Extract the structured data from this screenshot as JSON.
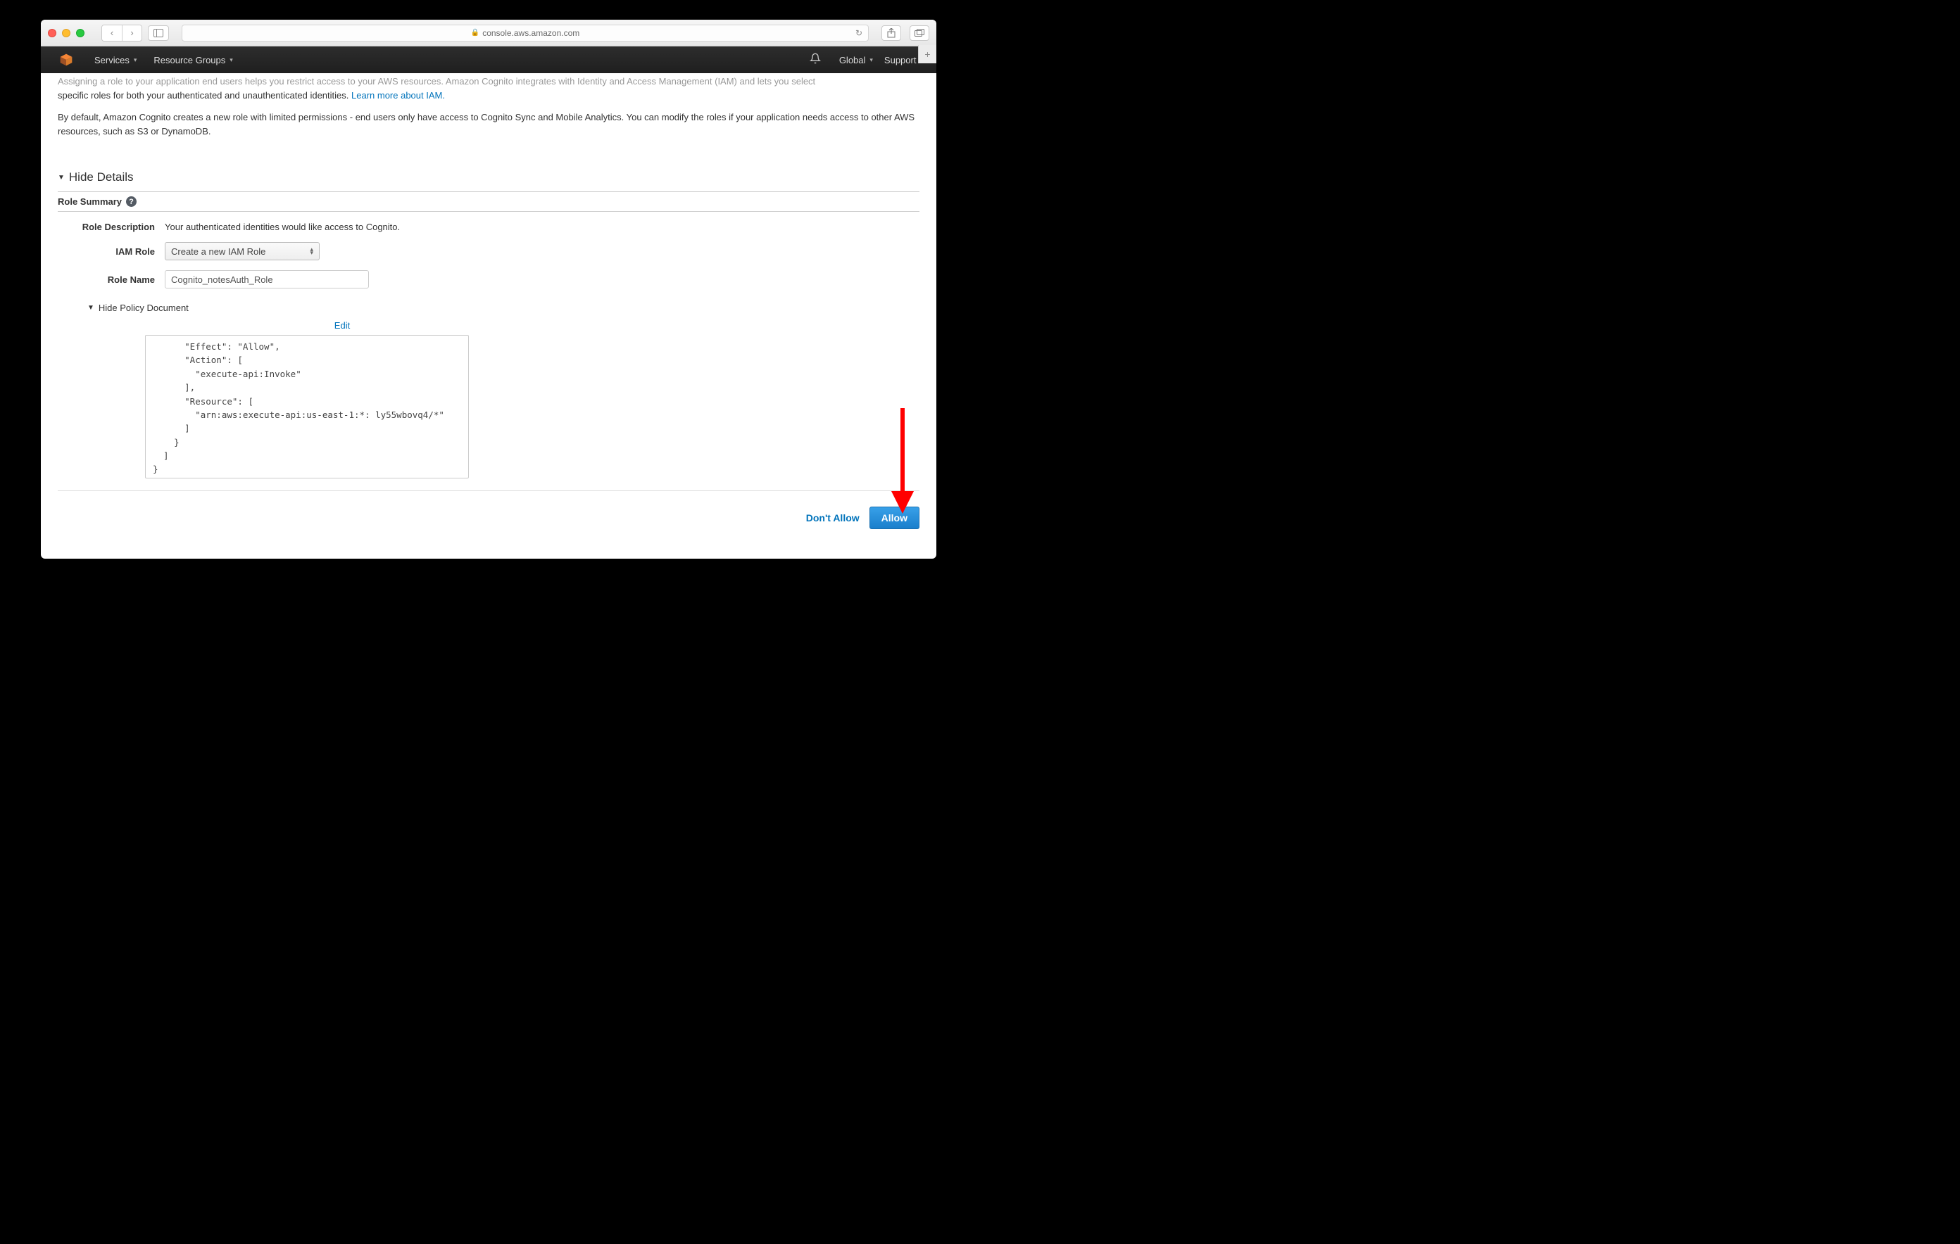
{
  "browser": {
    "url_host": "console.aws.amazon.com"
  },
  "aws_nav": {
    "services": "Services",
    "resource_groups": "Resource Groups",
    "region": "Global",
    "support": "Support"
  },
  "content": {
    "intro_line1_cut": "Assigning a role to your application end users helps you restrict access to your AWS resources. Amazon Cognito integrates with Identity and Access Management (IAM) and lets you select",
    "intro_line2": "specific roles for both your authenticated and unauthenticated identities. ",
    "iam_link": "Learn more about IAM.",
    "para2": "By default, Amazon Cognito creates a new role with limited permissions - end users only have access to Cognito Sync and Mobile Analytics. You can modify the roles if your application needs access to other AWS resources, such as S3 or DynamoDB.",
    "hide_details": "Hide Details",
    "role_summary": "Role Summary",
    "labels": {
      "role_description": "Role Description",
      "iam_role": "IAM Role",
      "role_name": "Role Name"
    },
    "values": {
      "role_description": "Your authenticated identities would like access to Cognito.",
      "iam_role_selected": "Create a new IAM Role",
      "role_name": "Cognito_notesAuth_Role"
    },
    "hide_policy": "Hide Policy Document",
    "edit": "Edit",
    "policy_text": "      \"Effect\": \"Allow\",\n      \"Action\": [\n        \"execute-api:Invoke\"\n      ],\n      \"Resource\": [\n        \"arn:aws:execute-api:us-east-1:*: ly55wbovq4/*\"\n      ]\n    }\n  ]\n}"
  },
  "buttons": {
    "dont_allow": "Don't Allow",
    "allow": "Allow"
  }
}
